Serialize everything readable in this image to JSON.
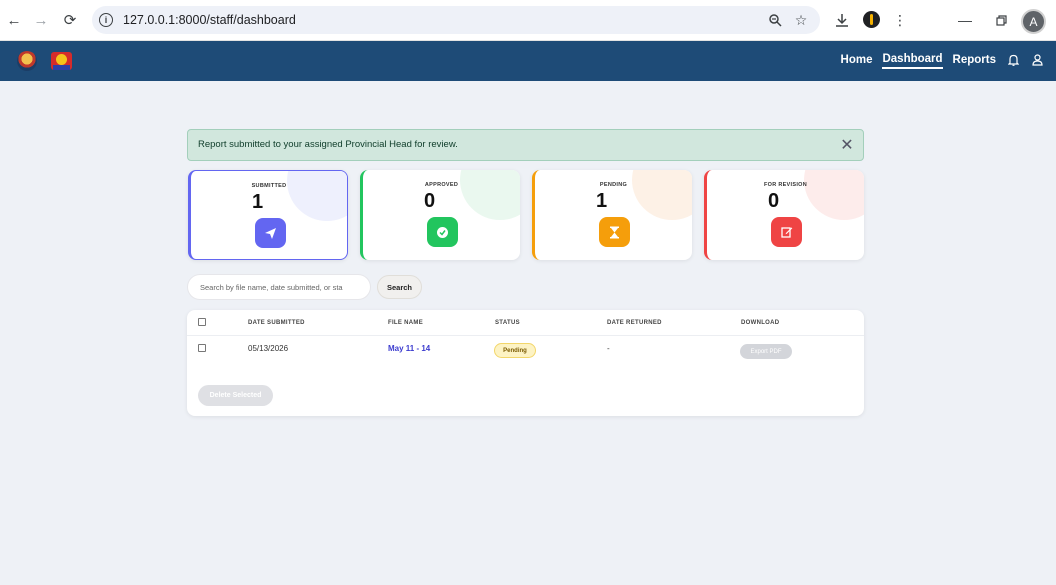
{
  "browser": {
    "url": "127.0.0.1:8000/staff/dashboard",
    "nav": {
      "back": "←",
      "forward": "→",
      "reload": "⟳"
    },
    "profile_initial": "A"
  },
  "navbar": {
    "links": [
      {
        "label": "Home",
        "active": false
      },
      {
        "label": "Dashboard",
        "active": true
      },
      {
        "label": "Reports",
        "active": false
      }
    ],
    "icons": [
      "bell-icon",
      "user-icon"
    ]
  },
  "alert": {
    "message": "Report submitted to your assigned Provincial Head for review.",
    "close": "✕"
  },
  "stats": [
    {
      "label": "SUBMITTED",
      "value": "1",
      "icon": "paper-plane-icon",
      "color": "#6366f1",
      "blob": "#eef0fd"
    },
    {
      "label": "APPROVED",
      "value": "0",
      "icon": "check-circle-icon",
      "color": "#22c55e",
      "blob": "#eaf8ef"
    },
    {
      "label": "PENDING",
      "value": "1",
      "icon": "hourglass-icon",
      "color": "#f59e0b",
      "blob": "#fdf1e6"
    },
    {
      "label": "FOR REVISION",
      "value": "0",
      "icon": "edit-icon",
      "color": "#ef4444",
      "blob": "#fdeceb"
    }
  ],
  "search": {
    "placeholder": "Search by file name, date submitted, or sta",
    "button": "Search"
  },
  "table": {
    "headers": [
      "DATE SUBMITTED",
      "FILE NAME",
      "STATUS",
      "DATE RETURNED",
      "DOWNLOAD"
    ],
    "rows": [
      {
        "date_submitted": "05/13/2026",
        "file_name": "May 11 - 14",
        "status": "Pending",
        "date_returned": "-",
        "download": "Export PDF"
      }
    ],
    "delete_button": "Delete Selected"
  }
}
